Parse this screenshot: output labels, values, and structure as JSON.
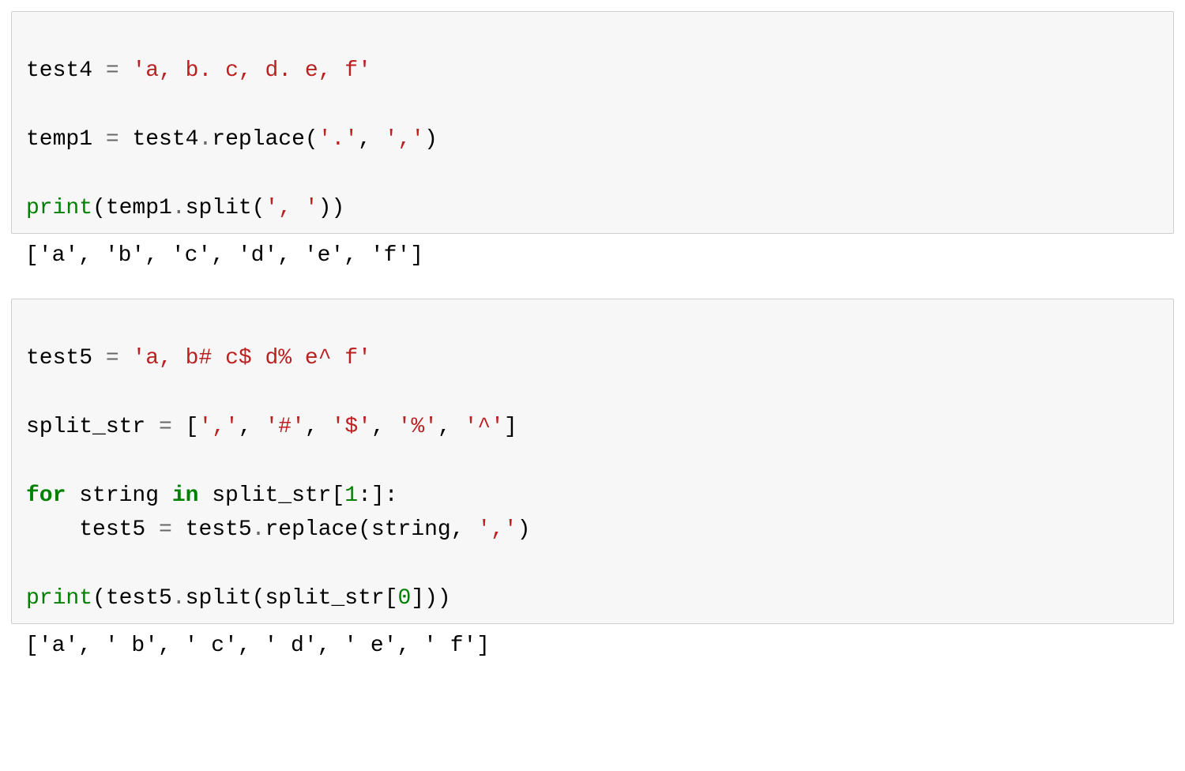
{
  "cell1": {
    "line1": {
      "a": "test4 ",
      "b": "=",
      "c": " ",
      "d": "'a, b. c, d. e, f'"
    },
    "line2": {
      "a": "temp1 ",
      "b": "=",
      "c": " test4",
      "d": ".",
      "e": "replace(",
      "f": "'.'",
      "g": ", ",
      "h": "','",
      "i": ")"
    },
    "line3": {
      "a": "print",
      "b": "(temp1",
      "c": ".",
      "d": "split(",
      "e": "', '",
      "f": "))"
    }
  },
  "out1": "['a', 'b', 'c', 'd', 'e', 'f']",
  "cell2": {
    "line1": {
      "a": "test5 ",
      "b": "=",
      "c": " ",
      "d": "'a, b# c$ d% e^ f'"
    },
    "line2": {
      "a": "split_str ",
      "b": "=",
      "c": " [",
      "d": "','",
      "e": ", ",
      "f": "'#'",
      "g": ", ",
      "h": "'$'",
      "i": ", ",
      "j": "'%'",
      "k": ", ",
      "l": "'^'",
      "m": "]"
    },
    "line3": {
      "a": "for",
      "b": " string ",
      "c": "in",
      "d": " split_str[",
      "e": "1",
      "f": ":]:"
    },
    "line4": {
      "a": "    test5 ",
      "b": "=",
      "c": " test5",
      "d": ".",
      "e": "replace(string, ",
      "f": "','",
      "g": ")"
    },
    "line5": {
      "a": "print",
      "b": "(test5",
      "c": ".",
      "d": "split(split_str[",
      "e": "0",
      "f": "]))"
    }
  },
  "out2": "['a', ' b', ' c', ' d', ' e', ' f']"
}
